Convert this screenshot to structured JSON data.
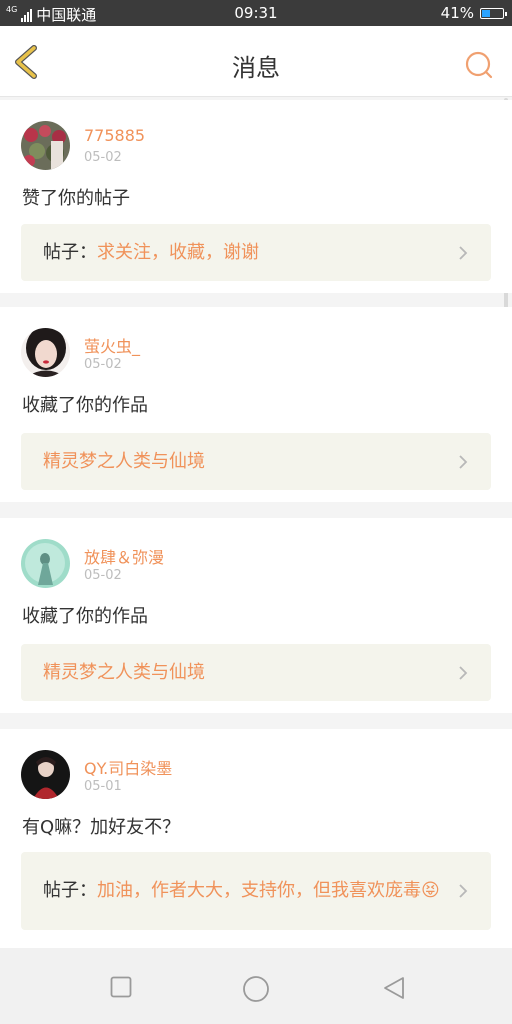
{
  "statusbar": {
    "network": "4G",
    "carrier": "中国联通",
    "time": "09:31",
    "battery": "41%",
    "battery_level": 0.41
  },
  "header": {
    "title": "消息",
    "back_icon": "chevron-left-icon",
    "search_icon": "search-icon"
  },
  "colors": {
    "accent": "#f0925a",
    "back_arrow": "#e8c24a",
    "quote_bg": "#f4f4ec"
  },
  "messages": [
    {
      "username": "775885",
      "date": "05-02",
      "text": "赞了你的帖子",
      "quote_label": "帖子：",
      "quote_text": "求关注，收藏，谢谢"
    },
    {
      "username": "萤火虫_",
      "date": "05-02",
      "text": "收藏了你的作品",
      "quote_label": "",
      "quote_text": "精灵梦之人类与仙境"
    },
    {
      "username": "放肆＆弥漫",
      "date": "05-02",
      "text": "收藏了你的作品",
      "quote_label": "",
      "quote_text": "精灵梦之人类与仙境"
    },
    {
      "username": "QY.司白染墨",
      "date": "05-01",
      "text": "有Q嘛？加好友不？",
      "quote_label": "帖子：",
      "quote_text": "加油，作者大大，支持你，但我喜欢庞毒😝"
    }
  ],
  "navbar": {
    "recents_icon": "square-icon",
    "home_icon": "circle-icon",
    "back_icon": "triangle-back-icon"
  }
}
